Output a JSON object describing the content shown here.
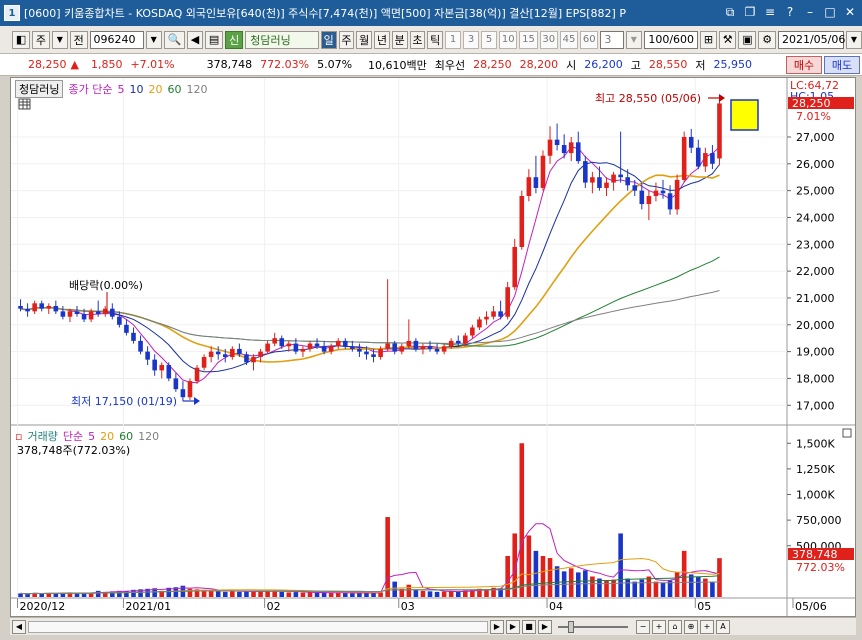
{
  "window": {
    "number": "1",
    "title": "[0600] 키움종합차트 - KOSDAQ 외국인보유[640(천)] 주식수[7,474(천)] 액면[500] 자본금[38(억)] 결산[12월] EPS[882] P"
  },
  "toolbar": {
    "type_label": "주",
    "prev_label": "전",
    "code": "096240",
    "new_badge": "신",
    "stock_name": "청담러닝",
    "periods": [
      "일",
      "주",
      "월",
      "년",
      "분",
      "초",
      "틱"
    ],
    "selected_period": "일",
    "minute_options": [
      "1",
      "3",
      "5",
      "10",
      "15",
      "30",
      "45",
      "60"
    ],
    "minute_select": "3",
    "count": "100/600",
    "date": "2021/05/06"
  },
  "quote": {
    "price": "28,250",
    "change": "1,850",
    "change_pct": "+7.01%",
    "volume": "378,748",
    "volume_pct": "772.03%",
    "turnover": "5.07%",
    "amount": "10,610백만",
    "pref_label": "최우선",
    "ask": "28,250",
    "bid": "28,200",
    "open_label": "시",
    "open": "26,200",
    "high_label": "고",
    "high": "28,550",
    "low_label": "저",
    "low": "25,950",
    "buy_label": "매수",
    "sell_label": "매도"
  },
  "price_panel": {
    "stock_tag": "청담러닝",
    "legend_label": "종가 단순",
    "ma_periods": [
      {
        "period": "5",
        "color": "#c020c0"
      },
      {
        "period": "10",
        "color": "#1a30a0"
      },
      {
        "period": "20",
        "color": "#e0a010"
      },
      {
        "period": "60",
        "color": "#208030"
      },
      {
        "period": "120",
        "color": "#808080"
      }
    ],
    "lc_label": "LC:64,72",
    "hc_label": "HC:1,05",
    "current_price_tag": "28,250",
    "current_pct_tag": "7.01%",
    "high_annotation": "최고 28,550 (05/06)",
    "low_annotation": "최저 17,150 (01/19)",
    "dividend_annotation": "배당락(0.00%)",
    "y_ticks": [
      "27,000",
      "26,000",
      "25,000",
      "24,000",
      "23,000",
      "22,000",
      "21,000",
      "20,000",
      "19,000",
      "18,000",
      "17,000"
    ]
  },
  "volume_panel": {
    "legend_label": "거래량",
    "legend_sub": "단순",
    "ma_periods": [
      {
        "period": "5",
        "color": "#c020c0"
      },
      {
        "period": "20",
        "color": "#e0a010"
      },
      {
        "period": "60",
        "color": "#208030"
      },
      {
        "period": "120",
        "color": "#808080"
      }
    ],
    "value_text": "378,748주(772.03%)",
    "current_tag": "378,748",
    "current_pct_tag": "772.03%",
    "y_ticks": [
      "1,500K",
      "1,250K",
      "1,000K",
      "750,000",
      "500,000"
    ]
  },
  "x_axis": {
    "labels": [
      "2020/12",
      "2021/01",
      "02",
      "03",
      "04",
      "05",
      "05/06"
    ]
  },
  "chart_data": {
    "type": "candlestick",
    "y_range": [
      16600,
      28900
    ],
    "volume_range": [
      0,
      1600000
    ],
    "candles": [
      {
        "o": 20700,
        "h": 20950,
        "l": 20500,
        "c": 20600,
        "v": 35000
      },
      {
        "o": 20600,
        "h": 20800,
        "l": 20300,
        "c": 20500,
        "v": 30000
      },
      {
        "o": 20500,
        "h": 20900,
        "l": 20400,
        "c": 20800,
        "v": 40000
      },
      {
        "o": 20800,
        "h": 20900,
        "l": 20500,
        "c": 20600,
        "v": 32000
      },
      {
        "o": 20600,
        "h": 20800,
        "l": 20400,
        "c": 20700,
        "v": 38000
      },
      {
        "o": 20700,
        "h": 20900,
        "l": 20400,
        "c": 20500,
        "v": 36000
      },
      {
        "o": 20500,
        "h": 20700,
        "l": 20200,
        "c": 20300,
        "v": 40000
      },
      {
        "o": 20300,
        "h": 20600,
        "l": 20100,
        "c": 20500,
        "v": 45000
      },
      {
        "o": 20500,
        "h": 20700,
        "l": 20300,
        "c": 20400,
        "v": 35000
      },
      {
        "o": 20400,
        "h": 20600,
        "l": 20100,
        "c": 20200,
        "v": 38000
      },
      {
        "o": 20200,
        "h": 20600,
        "l": 20100,
        "c": 20500,
        "v": 42000
      },
      {
        "o": 20500,
        "h": 20900,
        "l": 20300,
        "c": 20400,
        "v": 60000
      },
      {
        "o": 20400,
        "h": 20700,
        "l": 20300,
        "c": 20600,
        "v": 50000
      },
      {
        "o": 20600,
        "h": 20800,
        "l": 20200,
        "c": 20300,
        "v": 55000
      },
      {
        "o": 20300,
        "h": 20500,
        "l": 19900,
        "c": 20000,
        "v": 60000
      },
      {
        "o": 20000,
        "h": 20200,
        "l": 19600,
        "c": 19700,
        "v": 58000
      },
      {
        "o": 19700,
        "h": 19900,
        "l": 19300,
        "c": 19400,
        "v": 70000
      },
      {
        "o": 19400,
        "h": 19600,
        "l": 18900,
        "c": 19000,
        "v": 75000
      },
      {
        "o": 19000,
        "h": 19200,
        "l": 18500,
        "c": 18700,
        "v": 80000
      },
      {
        "o": 18700,
        "h": 18900,
        "l": 18100,
        "c": 18300,
        "v": 85000
      },
      {
        "o": 18300,
        "h": 18600,
        "l": 18000,
        "c": 18500,
        "v": 60000
      },
      {
        "o": 18500,
        "h": 18600,
        "l": 17900,
        "c": 18000,
        "v": 90000
      },
      {
        "o": 18000,
        "h": 18200,
        "l": 17500,
        "c": 17600,
        "v": 95000
      },
      {
        "o": 17600,
        "h": 17900,
        "l": 17150,
        "c": 17300,
        "v": 110000
      },
      {
        "o": 17300,
        "h": 18000,
        "l": 17200,
        "c": 17900,
        "v": 80000
      },
      {
        "o": 17900,
        "h": 18500,
        "l": 17800,
        "c": 18400,
        "v": 75000
      },
      {
        "o": 18400,
        "h": 18900,
        "l": 18300,
        "c": 18800,
        "v": 70000
      },
      {
        "o": 18800,
        "h": 19200,
        "l": 18600,
        "c": 19000,
        "v": 65000
      },
      {
        "o": 19000,
        "h": 19200,
        "l": 18700,
        "c": 18900,
        "v": 55000
      },
      {
        "o": 18900,
        "h": 19100,
        "l": 18600,
        "c": 18800,
        "v": 50000
      },
      {
        "o": 18800,
        "h": 19200,
        "l": 18700,
        "c": 19100,
        "v": 60000
      },
      {
        "o": 19100,
        "h": 19300,
        "l": 18800,
        "c": 18900,
        "v": 50000
      },
      {
        "o": 18900,
        "h": 19000,
        "l": 18500,
        "c": 18600,
        "v": 58000
      },
      {
        "o": 18600,
        "h": 18900,
        "l": 18300,
        "c": 18800,
        "v": 52000
      },
      {
        "o": 18800,
        "h": 19100,
        "l": 18600,
        "c": 19000,
        "v": 55000
      },
      {
        "o": 19000,
        "h": 19400,
        "l": 18900,
        "c": 19300,
        "v": 60000
      },
      {
        "o": 19300,
        "h": 19700,
        "l": 19200,
        "c": 19500,
        "v": 65000
      },
      {
        "o": 19500,
        "h": 19600,
        "l": 19100,
        "c": 19200,
        "v": 50000
      },
      {
        "o": 19200,
        "h": 19400,
        "l": 19000,
        "c": 19300,
        "v": 45000
      },
      {
        "o": 19300,
        "h": 19500,
        "l": 18900,
        "c": 19000,
        "v": 48000
      },
      {
        "o": 19000,
        "h": 19200,
        "l": 18800,
        "c": 19100,
        "v": 42000
      },
      {
        "o": 19100,
        "h": 19400,
        "l": 19000,
        "c": 19300,
        "v": 46000
      },
      {
        "o": 19300,
        "h": 19500,
        "l": 19100,
        "c": 19200,
        "v": 40000
      },
      {
        "o": 19200,
        "h": 19400,
        "l": 18900,
        "c": 19000,
        "v": 44000
      },
      {
        "o": 19000,
        "h": 19300,
        "l": 18900,
        "c": 19200,
        "v": 40000
      },
      {
        "o": 19200,
        "h": 19500,
        "l": 19100,
        "c": 19400,
        "v": 42000
      },
      {
        "o": 19400,
        "h": 19500,
        "l": 19100,
        "c": 19200,
        "v": 38000
      },
      {
        "o": 19200,
        "h": 19400,
        "l": 19000,
        "c": 19100,
        "v": 36000
      },
      {
        "o": 19100,
        "h": 19300,
        "l": 18800,
        "c": 19000,
        "v": 40000
      },
      {
        "o": 19000,
        "h": 19200,
        "l": 18700,
        "c": 18900,
        "v": 38000
      },
      {
        "o": 18900,
        "h": 19100,
        "l": 18600,
        "c": 18800,
        "v": 42000
      },
      {
        "o": 18800,
        "h": 19200,
        "l": 18700,
        "c": 19100,
        "v": 45000
      },
      {
        "o": 19100,
        "h": 21700,
        "l": 19000,
        "c": 19300,
        "v": 780000
      },
      {
        "o": 19300,
        "h": 19400,
        "l": 18900,
        "c": 19000,
        "v": 150000
      },
      {
        "o": 19000,
        "h": 19300,
        "l": 18900,
        "c": 19200,
        "v": 80000
      },
      {
        "o": 19200,
        "h": 20200,
        "l": 19100,
        "c": 19400,
        "v": 120000
      },
      {
        "o": 19400,
        "h": 19500,
        "l": 19000,
        "c": 19100,
        "v": 70000
      },
      {
        "o": 19100,
        "h": 19300,
        "l": 18900,
        "c": 19200,
        "v": 60000
      },
      {
        "o": 19200,
        "h": 19400,
        "l": 19000,
        "c": 19100,
        "v": 55000
      },
      {
        "o": 19100,
        "h": 19300,
        "l": 18900,
        "c": 19000,
        "v": 50000
      },
      {
        "o": 19000,
        "h": 19300,
        "l": 18900,
        "c": 19200,
        "v": 52000
      },
      {
        "o": 19200,
        "h": 19500,
        "l": 19100,
        "c": 19400,
        "v": 58000
      },
      {
        "o": 19400,
        "h": 19600,
        "l": 19200,
        "c": 19300,
        "v": 50000
      },
      {
        "o": 19300,
        "h": 19700,
        "l": 19200,
        "c": 19600,
        "v": 62000
      },
      {
        "o": 19600,
        "h": 20000,
        "l": 19500,
        "c": 19900,
        "v": 70000
      },
      {
        "o": 19900,
        "h": 20300,
        "l": 19800,
        "c": 20200,
        "v": 80000
      },
      {
        "o": 20200,
        "h": 20500,
        "l": 20000,
        "c": 20300,
        "v": 75000
      },
      {
        "o": 20300,
        "h": 20700,
        "l": 20200,
        "c": 20500,
        "v": 90000
      },
      {
        "o": 20500,
        "h": 20900,
        "l": 20200,
        "c": 20300,
        "v": 85000
      },
      {
        "o": 20300,
        "h": 21600,
        "l": 20200,
        "c": 21400,
        "v": 400000
      },
      {
        "o": 21400,
        "h": 23200,
        "l": 21300,
        "c": 22900,
        "v": 620000
      },
      {
        "o": 22900,
        "h": 25000,
        "l": 22800,
        "c": 24800,
        "v": 1500000
      },
      {
        "o": 24800,
        "h": 25800,
        "l": 24600,
        "c": 25500,
        "v": 600000
      },
      {
        "o": 25500,
        "h": 26300,
        "l": 24900,
        "c": 25100,
        "v": 450000
      },
      {
        "o": 25100,
        "h": 26500,
        "l": 25000,
        "c": 26300,
        "v": 400000
      },
      {
        "o": 26300,
        "h": 27400,
        "l": 26000,
        "c": 26900,
        "v": 380000
      },
      {
        "o": 26900,
        "h": 27500,
        "l": 26500,
        "c": 26700,
        "v": 300000
      },
      {
        "o": 26700,
        "h": 27100,
        "l": 26200,
        "c": 26400,
        "v": 250000
      },
      {
        "o": 26400,
        "h": 27000,
        "l": 26100,
        "c": 26800,
        "v": 280000
      },
      {
        "o": 26800,
        "h": 27200,
        "l": 26000,
        "c": 26100,
        "v": 240000
      },
      {
        "o": 26100,
        "h": 26300,
        "l": 25100,
        "c": 25300,
        "v": 260000
      },
      {
        "o": 25300,
        "h": 25700,
        "l": 24900,
        "c": 25500,
        "v": 200000
      },
      {
        "o": 25500,
        "h": 25900,
        "l": 25000,
        "c": 25100,
        "v": 180000
      },
      {
        "o": 25100,
        "h": 25500,
        "l": 24800,
        "c": 25300,
        "v": 160000
      },
      {
        "o": 25300,
        "h": 25700,
        "l": 25000,
        "c": 25600,
        "v": 170000
      },
      {
        "o": 25600,
        "h": 27200,
        "l": 25300,
        "c": 25500,
        "v": 620000
      },
      {
        "o": 25500,
        "h": 25800,
        "l": 25000,
        "c": 25200,
        "v": 180000
      },
      {
        "o": 25200,
        "h": 25400,
        "l": 24800,
        "c": 25000,
        "v": 150000
      },
      {
        "o": 25000,
        "h": 25300,
        "l": 24300,
        "c": 24500,
        "v": 170000
      },
      {
        "o": 24500,
        "h": 25000,
        "l": 23900,
        "c": 24800,
        "v": 200000
      },
      {
        "o": 24800,
        "h": 25300,
        "l": 24600,
        "c": 25000,
        "v": 150000
      },
      {
        "o": 25000,
        "h": 25400,
        "l": 24700,
        "c": 24900,
        "v": 140000
      },
      {
        "o": 24900,
        "h": 25200,
        "l": 24100,
        "c": 24300,
        "v": 160000
      },
      {
        "o": 24300,
        "h": 25600,
        "l": 24100,
        "c": 25400,
        "v": 240000
      },
      {
        "o": 25400,
        "h": 27200,
        "l": 25300,
        "c": 27000,
        "v": 450000
      },
      {
        "o": 27000,
        "h": 27300,
        "l": 26400,
        "c": 26600,
        "v": 220000
      },
      {
        "o": 26600,
        "h": 26900,
        "l": 25800,
        "c": 25900,
        "v": 200000
      },
      {
        "o": 25900,
        "h": 26600,
        "l": 25700,
        "c": 26400,
        "v": 180000
      },
      {
        "o": 26400,
        "h": 26700,
        "l": 25800,
        "c": 26000,
        "v": 150000
      },
      {
        "o": 26200,
        "h": 28550,
        "l": 25950,
        "c": 28250,
        "v": 378748
      }
    ]
  }
}
